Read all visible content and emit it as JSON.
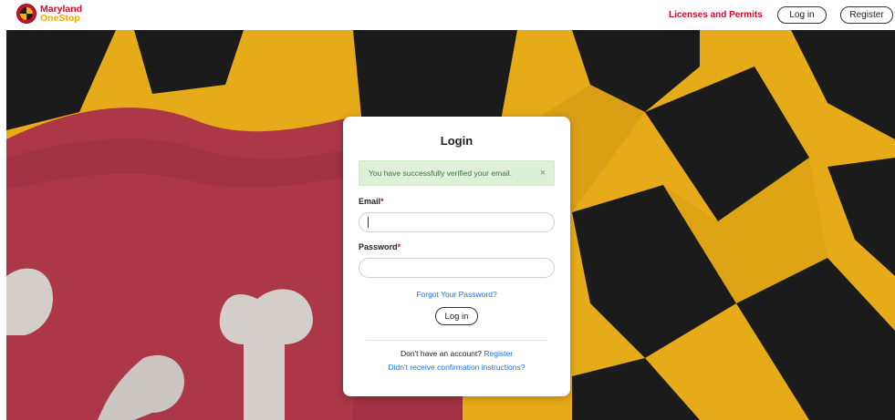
{
  "header": {
    "logo": {
      "line1": "Maryland",
      "line2": "OneStop",
      "icon": "maryland-seal-icon"
    },
    "nav_link": "Licenses and Permits",
    "login_label": "Log in",
    "register_label": "Register"
  },
  "colors": {
    "brand_red": "#c8102e",
    "brand_gold": "#f2b519",
    "flag_black": "#1b1b1b",
    "alert_bg": "#dff0d8",
    "alert_text": "#3c763d",
    "link_blue": "#1a73e8"
  },
  "login": {
    "title": "Login",
    "alert": {
      "message": "You have successfully verified your email.",
      "close": "×"
    },
    "email": {
      "label": "Email",
      "required": "*",
      "value": "",
      "placeholder": ""
    },
    "password": {
      "label": "Password",
      "required": "*",
      "value": "",
      "placeholder": ""
    },
    "forgot_link": "Forgot Your Password?",
    "submit_label": "Log in",
    "no_account_text": "Don't have an account?",
    "register_link": "Register",
    "confirm_link": "Didn't receive confirmation instructions?"
  }
}
